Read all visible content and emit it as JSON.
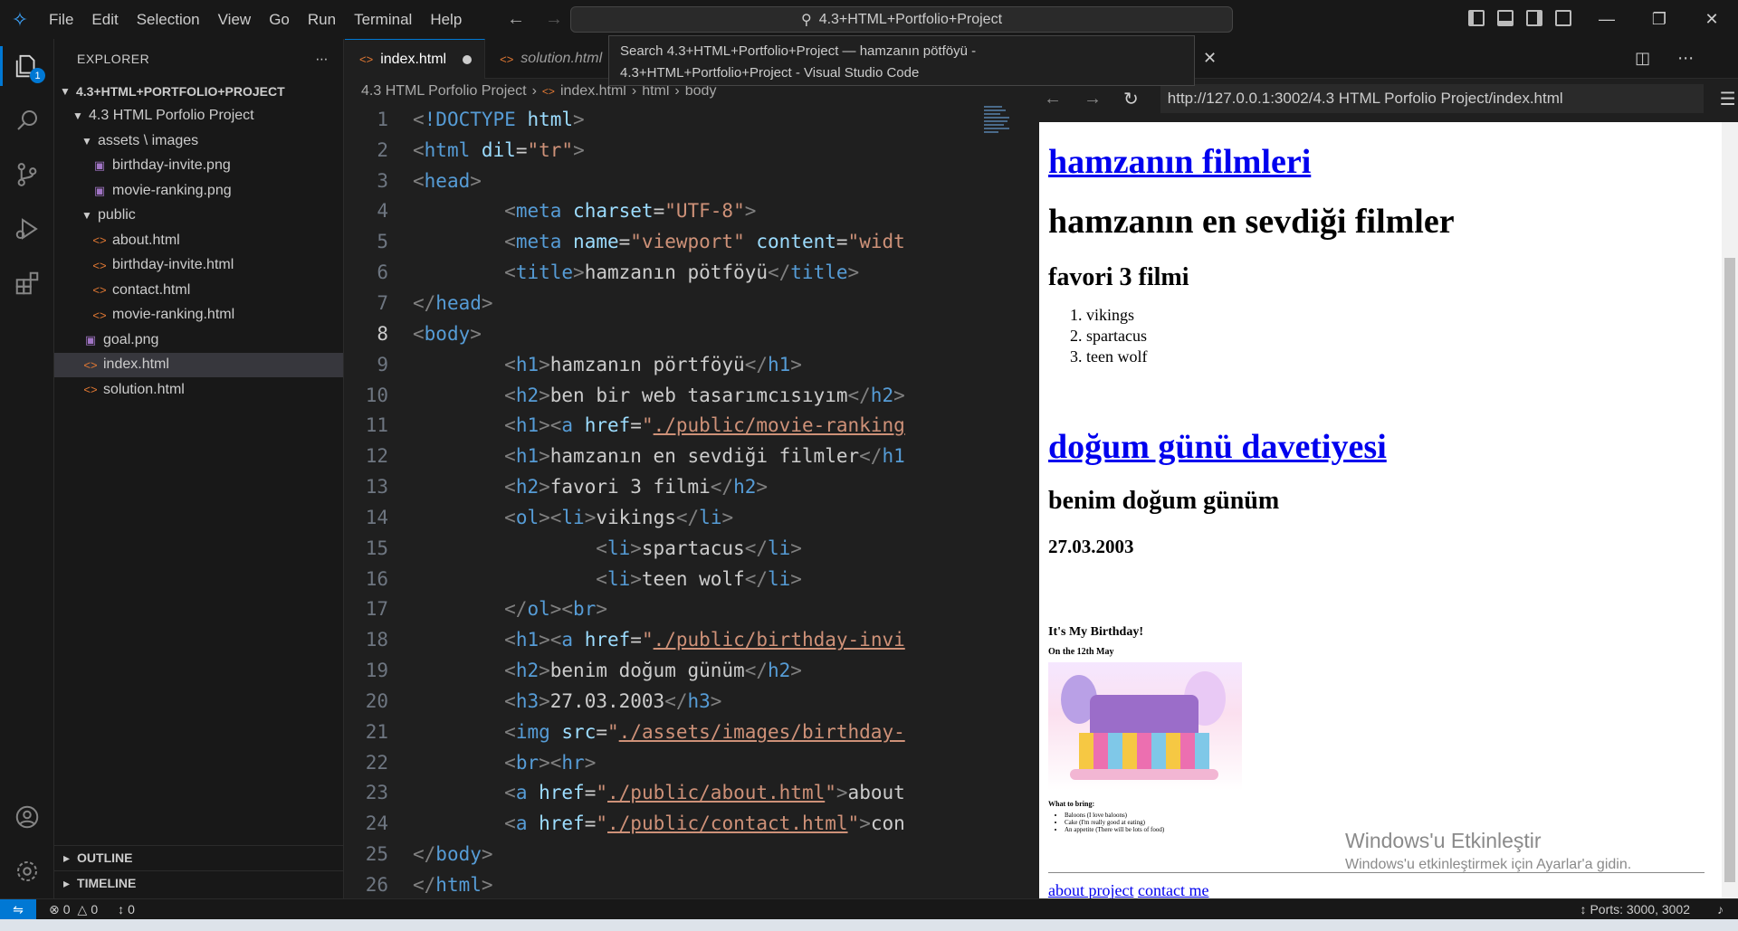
{
  "titlebar": {
    "menu": [
      "File",
      "Edit",
      "Selection",
      "View",
      "Go",
      "Run",
      "Terminal",
      "Help"
    ],
    "command_center": "4.3+HTML+Portfolio+Project"
  },
  "tooltip": {
    "line1": "Search 4.3+HTML+Portfolio+Project — hamzanın pötföyü -",
    "line2": "4.3+HTML+Portfolio+Project - Visual Studio Code"
  },
  "activity": {
    "explorer_badge": "1"
  },
  "sidebar": {
    "title": "EXPLORER",
    "root": "4.3+HTML+PORTFOLIO+PROJECT",
    "folder": "4.3 HTML Porfolio Project",
    "assets": "assets \\ images",
    "files": {
      "birthday_png": "birthday-invite.png",
      "movie_png": "movie-ranking.png",
      "public": "public",
      "about": "about.html",
      "birthday_html": "birthday-invite.html",
      "contact": "contact.html",
      "movie_html": "movie-ranking.html",
      "goal": "goal.png",
      "index": "index.html",
      "solution": "solution.html"
    },
    "outline": "OUTLINE",
    "timeline": "TIMELINE"
  },
  "editor": {
    "tabs": [
      {
        "label": "index.html"
      },
      {
        "label": "solution.html"
      }
    ],
    "breadcrumb": [
      "4.3 HTML Porfolio Project",
      "index.html",
      "html",
      "body"
    ]
  },
  "browser": {
    "url": "http://127.0.0.1:3002/4.3 HTML Porfolio Project/index.html",
    "link_movies": "hamzanın filmleri",
    "h1_fav": "hamzanın en sevdiği filmler",
    "h2_top3": "favori 3 filmi",
    "movies": [
      "vikings",
      "spartacus",
      "teen wolf"
    ],
    "link_birthday": "doğum günü davetiyesi",
    "h2_birthday": "benim doğum günüm",
    "date": "27.03.2003",
    "card_title": "It's My Birthday!",
    "card_sub": "On the 12th May",
    "card_bring": "What to bring:",
    "card_items": [
      "Baloons (I love baloons)",
      "Cake (I'm really good at eating)",
      "An appetite (There will be lots of food)"
    ],
    "about_link": "about project",
    "contact_link": "contact me"
  },
  "watermark": {
    "line1": "Windows'u Etkinleştir",
    "line2": "Windows'u etkinleştirmek için Ayarlar'a gidin."
  },
  "statusbar": {
    "errors": "0",
    "warnings": "0",
    "ports_count": "0",
    "ports": "Ports: 3000, 3002"
  },
  "colors": {
    "accent": "#0078d4",
    "tag": "#569cd6",
    "attr": "#9cdcfe",
    "string": "#ce9178"
  }
}
